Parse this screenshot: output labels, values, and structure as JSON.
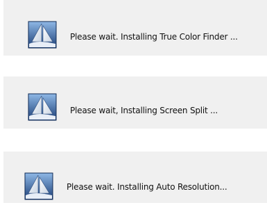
{
  "dialogs": [
    {
      "message": "Please wait. Installing True Color Finder ..."
    },
    {
      "message": "Please wait, Installing Screen Split ..."
    },
    {
      "message": "Please wait. Installing Auto Resolution..."
    }
  ],
  "icons": {
    "logo": "sail-logo-icon"
  },
  "colors": {
    "dialog_background": "#f0f0f0",
    "logo_blue_dark": "#1c3f77",
    "logo_blue_light": "#7aa6d9"
  }
}
